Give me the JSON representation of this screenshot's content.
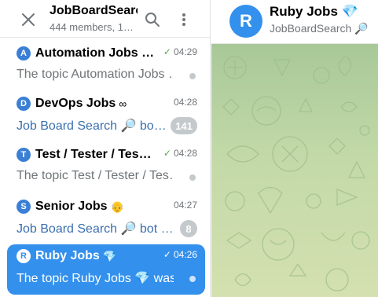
{
  "left_header": {
    "title": "JobBoardSearch",
    "subtitle": "444 members, 1…",
    "close_icon": "close-icon",
    "search_icon": "search-icon",
    "menu_icon": "more-vertical-icon"
  },
  "chats": [
    {
      "avatar_letter": "A",
      "title": "Automation Jobs …",
      "emoji": "",
      "time": "04:29",
      "sent_check": true,
      "preview": "The topic Automation Jobs …",
      "badge": ""
    },
    {
      "avatar_letter": "D",
      "title": "DevOps Jobs",
      "emoji": "∞",
      "time": "04:28",
      "sent_check": false,
      "preview": "Job Board Search 🔎 bo…",
      "badge": "141"
    },
    {
      "avatar_letter": "T",
      "title": "Test / Tester / Tes…",
      "emoji": "",
      "time": "04:28",
      "sent_check": true,
      "preview": "The topic Test / Tester / Tes…",
      "badge": ""
    },
    {
      "avatar_letter": "S",
      "title": "Senior Jobs",
      "emoji": "👴",
      "time": "04:27",
      "sent_check": false,
      "preview": "Job Board Search 🔎 bot …",
      "badge": "8"
    },
    {
      "avatar_letter": "R",
      "title": "Ruby Jobs",
      "emoji": "💎",
      "time": "04:26",
      "sent_check": true,
      "preview": "The topic Ruby Jobs 💎 was …",
      "badge": "",
      "active": true
    }
  ],
  "chat_header": {
    "avatar_letter": "R",
    "title": "Ruby Jobs 💎",
    "subtitle": "JobBoardSearch 🔎"
  },
  "colors": {
    "accent": "#3390ec",
    "wallpaper": "#b7d1a2",
    "badge": "#c4c9cc",
    "check": "#4fae4e"
  }
}
